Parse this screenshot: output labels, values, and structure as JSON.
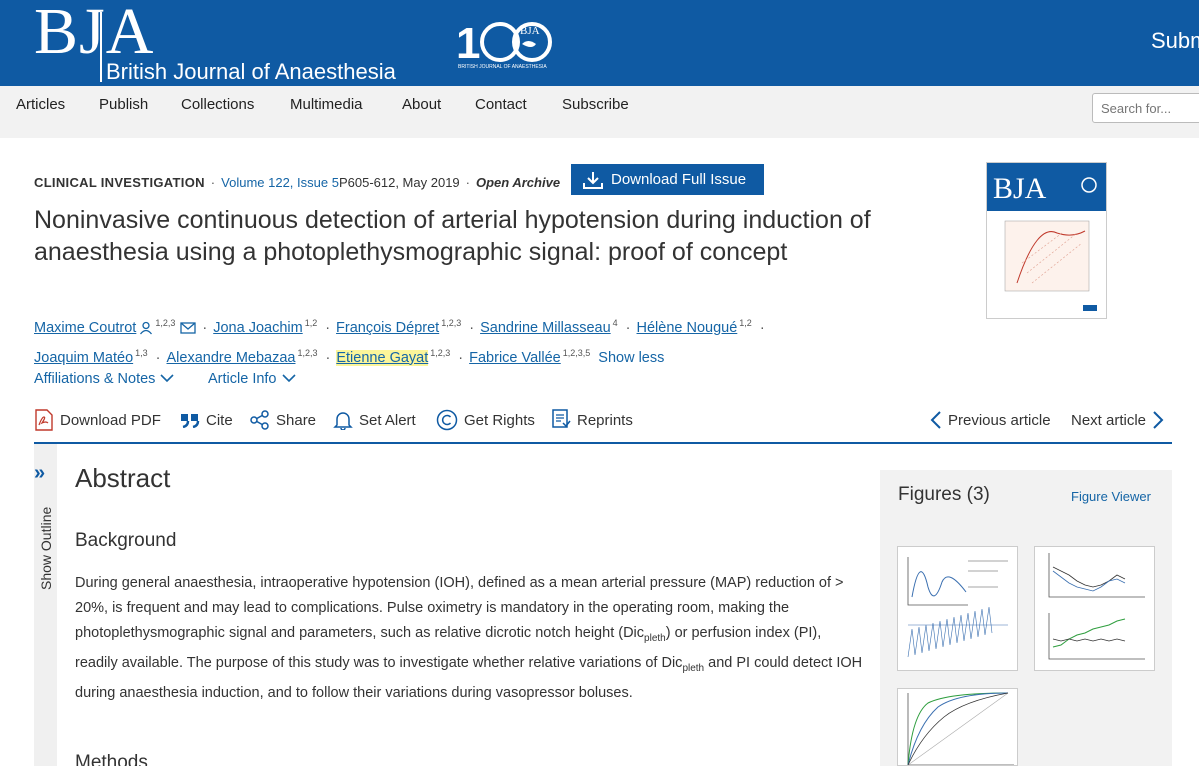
{
  "header": {
    "logo": "BJA",
    "journal_name": "British Journal of Anaesthesia",
    "anniversary_logo_text": "100",
    "submit_label": "Submit"
  },
  "nav": {
    "items": [
      "Articles",
      "Publish",
      "Collections",
      "Multimedia",
      "About",
      "Contact",
      "Subscribe"
    ],
    "search_placeholder": "Search for..."
  },
  "article": {
    "type": "CLINICAL INVESTIGATION",
    "volume": "Volume 122, Issue 5",
    "pages_date": "P605-612, May 2019",
    "access": "Open Archive",
    "download_issue_label": "Download Full Issue",
    "title": "Noninvasive continuous detection of arterial hypotension during induction of anaesthesia using a photoplethysmographic signal: proof of concept",
    "authors": [
      {
        "name": "Maxime Coutrot",
        "sup": "1,2,3"
      },
      {
        "name": "Jona Joachim",
        "sup": "1,2"
      },
      {
        "name": "François Dépret",
        "sup": "1,2,3"
      },
      {
        "name": "Sandrine Millasseau",
        "sup": "4"
      },
      {
        "name": "Hélène Nougué",
        "sup": "1,2"
      },
      {
        "name": "Joaquim Matéo",
        "sup": "1,3"
      },
      {
        "name": "Alexandre Mebazaa",
        "sup": "1,2,3"
      },
      {
        "name": "Etienne Gayat",
        "sup": "1,2,3"
      },
      {
        "name": "Fabrice Vallée",
        "sup": "1,2,3,5"
      }
    ],
    "show_less_label": "Show less",
    "affiliations_label": "Affiliations & Notes",
    "article_info_label": "Article Info"
  },
  "toolbar": {
    "download_pdf": "Download PDF",
    "cite": "Cite",
    "share": "Share",
    "set_alert": "Set Alert",
    "get_rights": "Get Rights",
    "reprints": "Reprints",
    "previous": "Previous article",
    "next": "Next article"
  },
  "outline": {
    "label": "Show Outline"
  },
  "abstract": {
    "heading": "Abstract",
    "background_heading": "Background",
    "p1": "During general anaesthesia, intraoperative hypotension (IOH), defined as a mean arterial pressure (MAP) reduction of > 20%, is frequent and may lead to complications. Pulse oximetry is mandatory in the operating room, making the photoplethysmographic signal and parameters, such as relative dicrotic notch height (Dic",
    "sub1": "pleth",
    "p2": ") or perfusion index (PI), readily available. The purpose of this study was to investigate whether relative variations of Dic",
    "sub2": "pleth",
    "p3": " and PI could detect IOH during anaesthesia induction, and to follow their variations during vasopressor boluses.",
    "methods_heading": "Methods"
  },
  "figures": {
    "title": "Figures (3)",
    "viewer_label": "Figure Viewer"
  },
  "cover": {
    "logo": "BJA"
  },
  "colors": {
    "brand_blue": "#0f5aa3",
    "link_blue": "#1565a6",
    "highlight": "#fbf59a"
  }
}
